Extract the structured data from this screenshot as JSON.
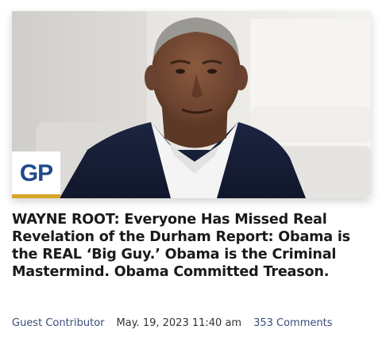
{
  "article": {
    "image_alt": "Barack Obama in a dark suit jacket and white open-collar shirt, seated in a bright room",
    "logo_text": "GP",
    "headline": "WAYNE ROOT: Everyone Has Missed Real Revelation of the Durham Report: Obama is the REAL ‘Big Guy.’ Obama is the Criminal Mastermind. Obama Committed Treason.",
    "author": "Guest Contributor",
    "date": "May. 19, 2023 11:40 am",
    "comments": "353 Comments"
  },
  "colors": {
    "headline": "#1a1a1a",
    "meta_link": "#3a4d7a",
    "logo_blue": "#1f4a8c",
    "logo_gold": "#d6a629"
  }
}
